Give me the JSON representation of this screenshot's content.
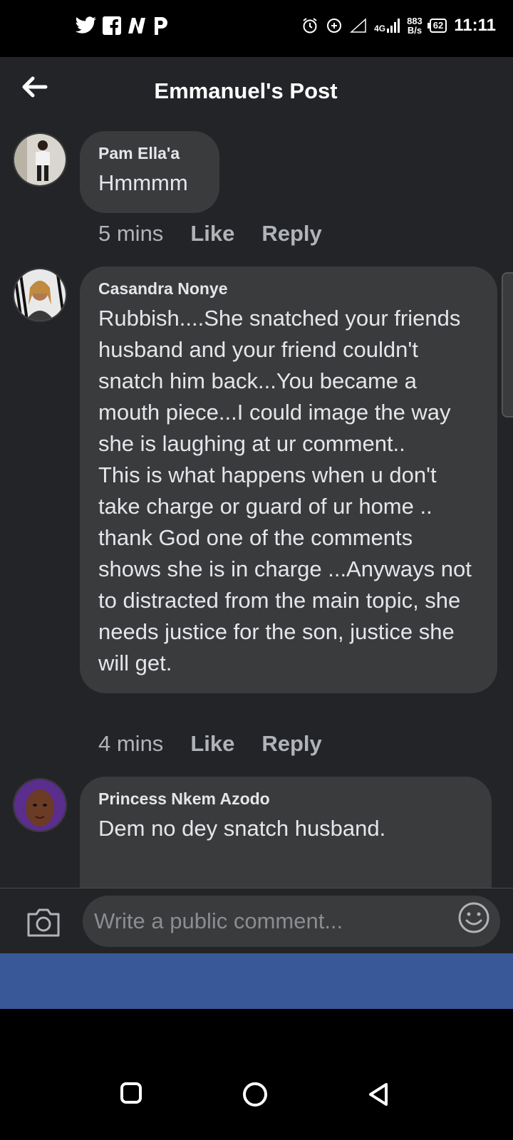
{
  "status_bar": {
    "apps": [
      "twitter-icon",
      "facebook-icon",
      "nairaland-icon",
      "p-app-icon"
    ],
    "network": "4G",
    "speed_value": "883",
    "speed_unit": "B/s",
    "battery": "62",
    "time": "11:11"
  },
  "header": {
    "title": "Emmanuel's Post"
  },
  "comments": [
    {
      "author": "Pam Ella'a",
      "text": "Hmmmm",
      "time": "5 mins",
      "like": "Like",
      "reply": "Reply"
    },
    {
      "author": "Casandra Nonye",
      "text": "Rubbish....She snatched your friends husband and your friend couldn't snatch him back...You became a mouth piece...I could image the way she is laughing at ur comment..\nThis is what happens when u don't take charge or guard of ur home .. thank God one of the comments shows she is in charge ...Anyways not to distracted from the main topic, she needs justice for the son, justice she will get.",
      "time": "4 mins",
      "like": "Like",
      "reply": "Reply"
    },
    {
      "author": "Princess Nkem Azodo",
      "text": "Dem no dey snatch husband."
    }
  ],
  "composer": {
    "placeholder": "Write a public comment..."
  },
  "colors": {
    "background": "#232427",
    "bubble": "#3a3b3c",
    "brand_blue": "#385898"
  }
}
